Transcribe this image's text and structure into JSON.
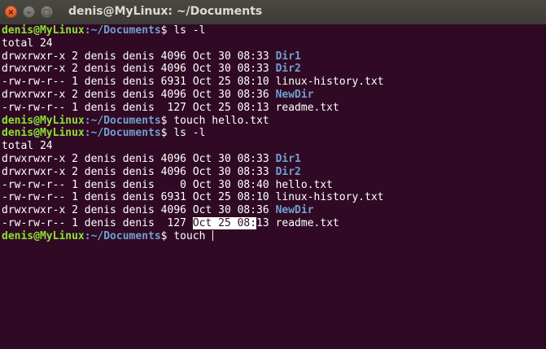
{
  "window": {
    "title": "denis@MyLinux: ~/Documents",
    "close_glyph": "×",
    "minimize_glyph": "–",
    "maximize_glyph": "□"
  },
  "prompt": {
    "user_host": "denis@MyLinux",
    "path_part": ":~/Documents",
    "symbol": "$"
  },
  "session": [
    {
      "command": "ls -l"
    },
    {
      "listing": {
        "total": "total 24",
        "entries": [
          {
            "perms": "drwxrwxr-x",
            "links": "2",
            "owner": "denis",
            "group": "denis",
            "size": "4096",
            "date": "Oct 30 08:33",
            "name": "Dir1",
            "is_dir": true
          },
          {
            "perms": "drwxrwxr-x",
            "links": "2",
            "owner": "denis",
            "group": "denis",
            "size": "4096",
            "date": "Oct 30 08:33",
            "name": "Dir2",
            "is_dir": true
          },
          {
            "perms": "-rw-rw-r--",
            "links": "1",
            "owner": "denis",
            "group": "denis",
            "size": "6931",
            "date": "Oct 25 08:10",
            "name": "linux-history.txt",
            "is_dir": false
          },
          {
            "perms": "drwxrwxr-x",
            "links": "2",
            "owner": "denis",
            "group": "denis",
            "size": "4096",
            "date": "Oct 30 08:36",
            "name": "NewDir",
            "is_dir": true
          },
          {
            "perms": "-rw-rw-r--",
            "links": "1",
            "owner": "denis",
            "group": "denis",
            "size": " 127",
            "date": "Oct 25 08:13",
            "name": "readme.txt",
            "is_dir": false
          }
        ]
      }
    },
    {
      "command": "touch hello.txt"
    },
    {
      "command": "ls -l"
    },
    {
      "listing": {
        "total": "total 24",
        "entries": [
          {
            "perms": "drwxrwxr-x",
            "links": "2",
            "owner": "denis",
            "group": "denis",
            "size": "4096",
            "date": "Oct 30 08:33",
            "name": "Dir1",
            "is_dir": true
          },
          {
            "perms": "drwxrwxr-x",
            "links": "2",
            "owner": "denis",
            "group": "denis",
            "size": "4096",
            "date": "Oct 30 08:33",
            "name": "Dir2",
            "is_dir": true
          },
          {
            "perms": "-rw-rw-r--",
            "links": "1",
            "owner": "denis",
            "group": "denis",
            "size": "   0",
            "date": "Oct 30 08:40",
            "name": "hello.txt",
            "is_dir": false
          },
          {
            "perms": "-rw-rw-r--",
            "links": "1",
            "owner": "denis",
            "group": "denis",
            "size": "6931",
            "date": "Oct 25 08:10",
            "name": "linux-history.txt",
            "is_dir": false
          },
          {
            "perms": "drwxrwxr-x",
            "links": "2",
            "owner": "denis",
            "group": "denis",
            "size": "4096",
            "date": "Oct 30 08:36",
            "name": "NewDir",
            "is_dir": true
          },
          {
            "perms": "-rw-rw-r--",
            "links": "1",
            "owner": "denis",
            "group": "denis",
            "size": " 127",
            "date": "Oct 25 08:13",
            "name": "readme.txt",
            "is_dir": false,
            "selected_text": "Oct 25 08:"
          }
        ]
      }
    },
    {
      "command": "touch ",
      "active": true
    }
  ]
}
